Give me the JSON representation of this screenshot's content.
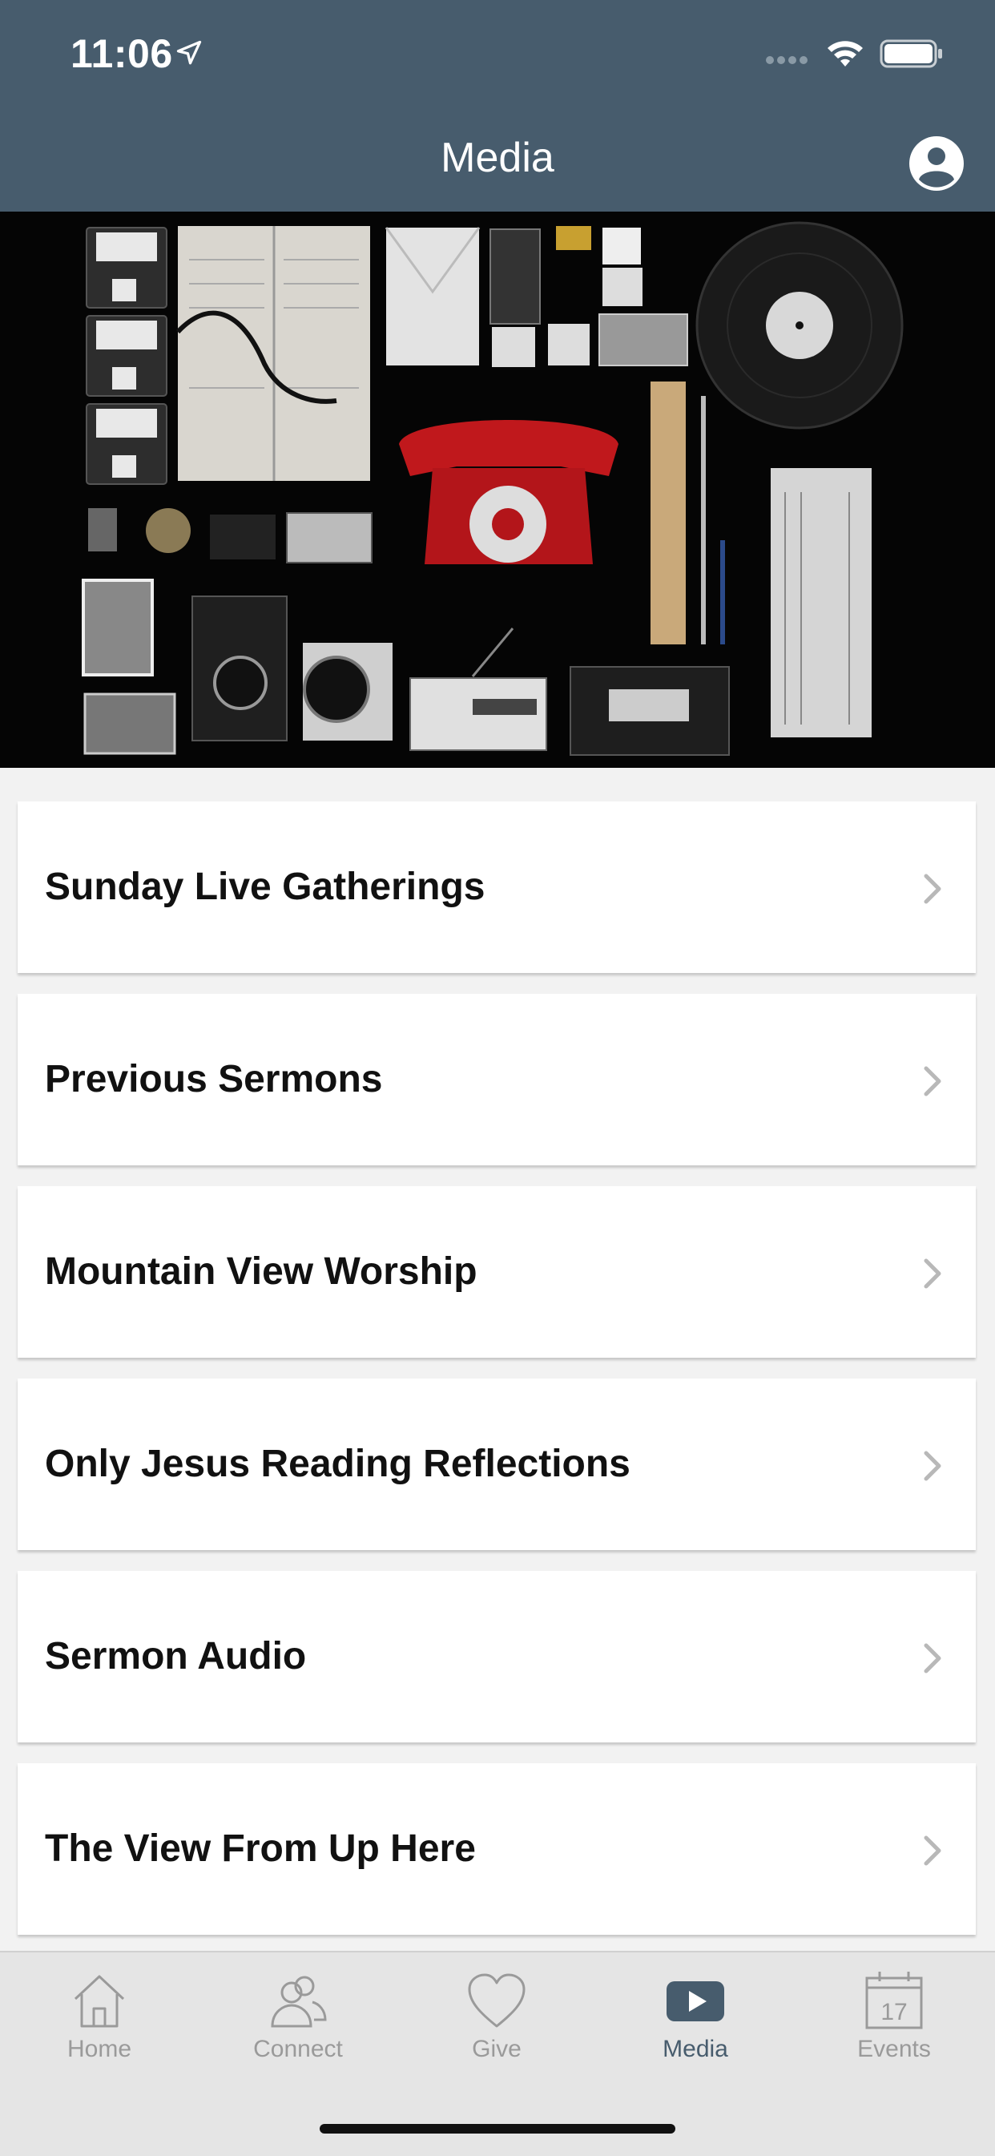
{
  "status_bar": {
    "time": "11:06"
  },
  "header": {
    "title": "Media"
  },
  "list": {
    "items": [
      {
        "label": "Sunday Live Gatherings"
      },
      {
        "label": "Previous Sermons"
      },
      {
        "label": "Mountain View Worship"
      },
      {
        "label": "Only Jesus Reading Reflections"
      },
      {
        "label": "Sermon Audio"
      },
      {
        "label": "The View From Up Here"
      }
    ]
  },
  "tabbar": {
    "items": [
      {
        "label": "Home",
        "icon": "home-icon"
      },
      {
        "label": "Connect",
        "icon": "people-icon"
      },
      {
        "label": "Give",
        "icon": "heart-icon"
      },
      {
        "label": "Media",
        "icon": "play-icon",
        "active": true
      },
      {
        "label": "Events",
        "icon": "calendar-icon",
        "calendar_day": "17"
      }
    ]
  },
  "colors": {
    "header_bg": "#475c6d",
    "active_tab": "#475c6d",
    "inactive_tab": "#9a9a9a"
  }
}
